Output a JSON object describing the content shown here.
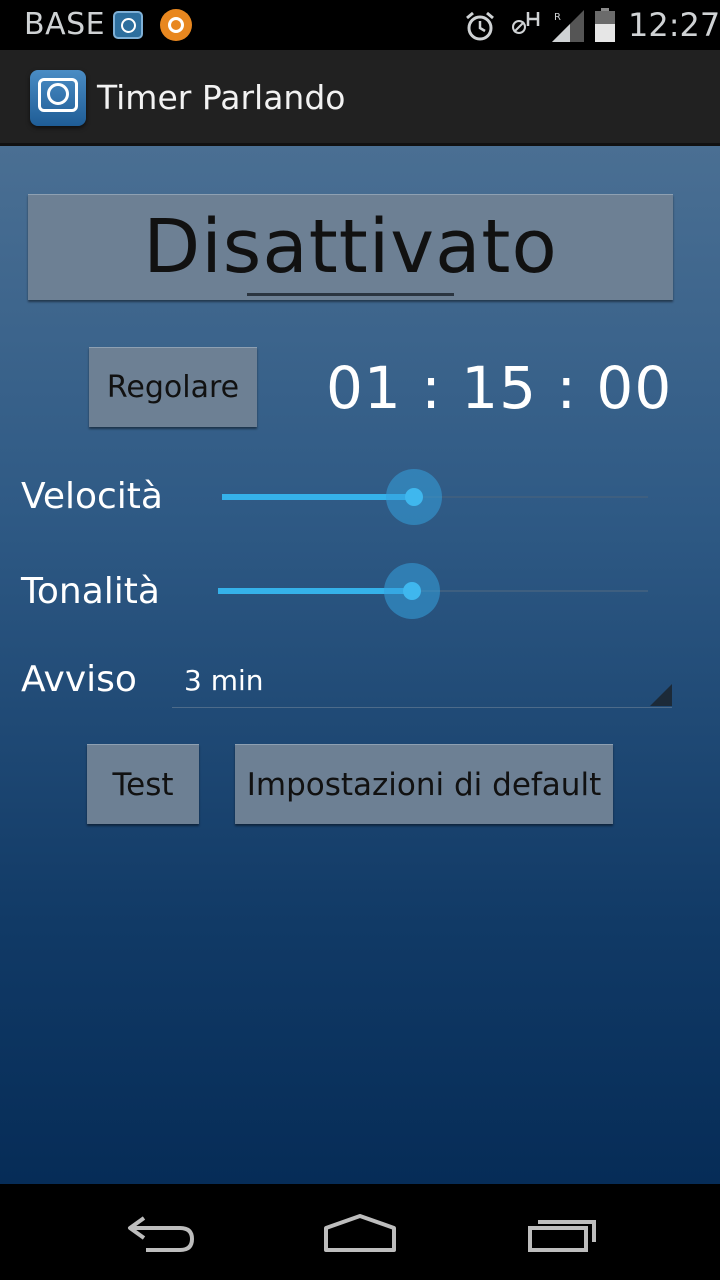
{
  "status_bar": {
    "carrier": "BASE",
    "time": "12:27",
    "icons": [
      "timer-app-icon",
      "orange-app-icon",
      "alarm-icon",
      "no-h-icon",
      "signal-icon",
      "battery-icon"
    ]
  },
  "action_bar": {
    "title": "Timer Parlando",
    "logo_icon": "timer-bubble-icon"
  },
  "main": {
    "status_button_label": "Disattivato",
    "adjust_button_label": "Regolare",
    "timer": "01 : 15 : 00",
    "speed": {
      "label": "Velocità",
      "value": 0.45
    },
    "pitch": {
      "label": "Tonalità",
      "value": 0.45
    },
    "warning": {
      "label": "Avviso",
      "selected": "3 min"
    },
    "test_button_label": "Test",
    "defaults_button_label": "Impostazioni di default"
  },
  "colors": {
    "accent": "#35b2ea",
    "button_bg": "#6d8094",
    "gradient_top": "#4a6f93",
    "gradient_bottom": "#062c57"
  },
  "nav_bar": {
    "icons": [
      "back-icon",
      "home-icon",
      "recents-icon"
    ]
  }
}
